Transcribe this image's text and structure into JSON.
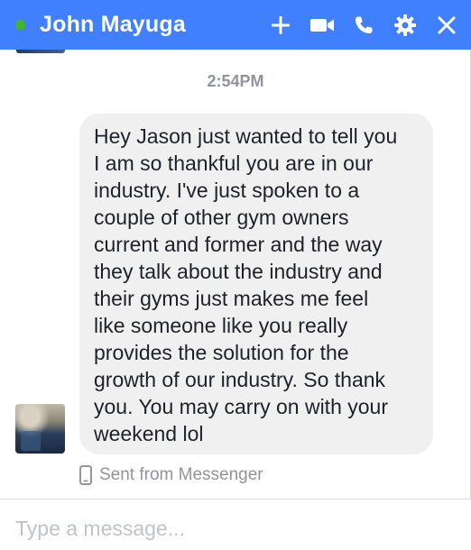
{
  "header": {
    "contact_name": "John Mayuga",
    "presence_color": "#42b72a",
    "background_color": "#4080ff",
    "icons": [
      "plus-icon",
      "video-icon",
      "phone-icon",
      "gear-icon",
      "close-icon"
    ]
  },
  "conversation": {
    "timestamp": "2:54PM",
    "message": {
      "text_lines": [
        "Hey Jason just wanted to tell you",
        "I am so thankful you are in our",
        "industry. I've just spoken to a",
        "couple of other gym owners",
        "current and former and the way",
        "they talk about the industry and",
        "their gyms just makes me feel",
        "like someone like you really",
        "provides the solution for the",
        "growth of our industry. So thank",
        "you. You may carry on with your",
        "weekend lol"
      ]
    },
    "sent_from": "Sent from Messenger"
  },
  "composer": {
    "placeholder": "Type a message..."
  }
}
